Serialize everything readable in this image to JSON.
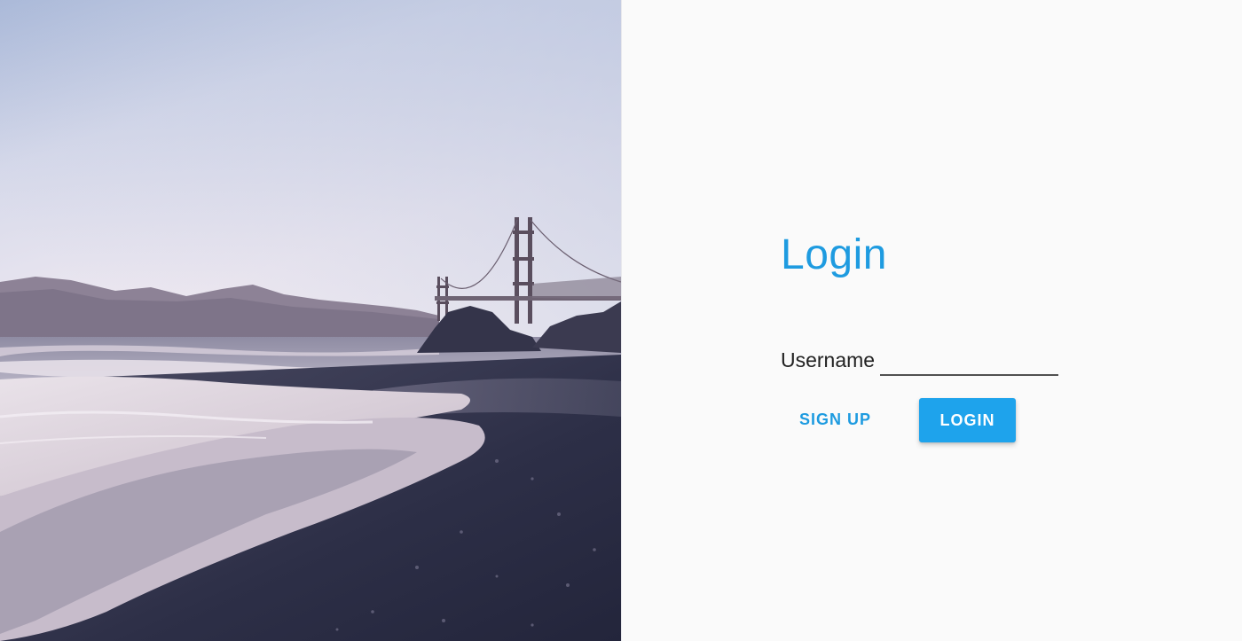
{
  "hero": {
    "image": "beach-golden-gate-bridge-photo"
  },
  "login": {
    "title": "Login",
    "username_label": "Username",
    "username_value": "",
    "signup_label": "SIGN UP",
    "login_label": "LOGIN"
  },
  "colors": {
    "accent": "#1e9be0",
    "button_bg": "#1ea3ec",
    "panel_bg": "#fafafa"
  }
}
